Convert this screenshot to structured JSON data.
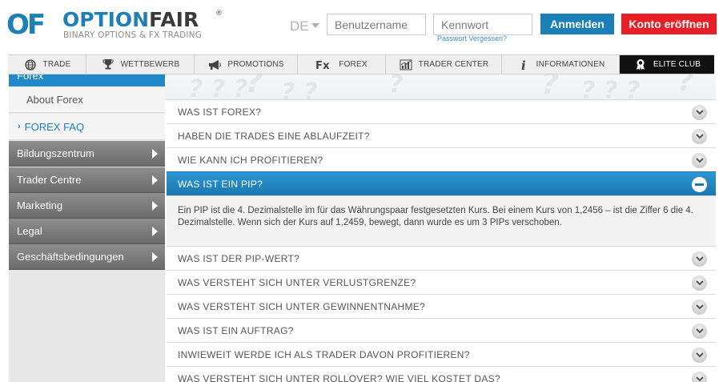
{
  "brand": {
    "logo_mark": "OF",
    "name_part1": "OPTION",
    "name_part2": "FAIR",
    "registered": "®",
    "tagline": "BINARY OPTIONS & FX TRADING"
  },
  "header": {
    "language": "DE",
    "username_placeholder": "Benutzername",
    "password_placeholder": "Kennwort",
    "forgot_password": "Passwort Vergessen?",
    "login_label": "Anmelden",
    "open_account_label": "Konto eröffnen",
    "colors": {
      "primary": "#1b7fb8",
      "danger": "#e81f24"
    }
  },
  "nav": {
    "items": [
      {
        "label": "TRADE",
        "icon": "globe-icon"
      },
      {
        "label": "WETTBEWERB",
        "icon": "trophy-icon"
      },
      {
        "label": "PROMOTIONS",
        "icon": "megaphone-icon"
      },
      {
        "label": "FOREX",
        "icon": "fx-icon"
      },
      {
        "label": "TRADER CENTER",
        "icon": "chart-icon"
      },
      {
        "label": "INFORMATIONEN",
        "icon": "info-icon"
      },
      {
        "label": "ELITE CLUB",
        "icon": "award-icon"
      }
    ]
  },
  "sidebar": {
    "active_section": "Forex",
    "sub_items": [
      {
        "label": "About Forex"
      },
      {
        "label": "FOREX FAQ",
        "chevron": "›"
      }
    ],
    "categories": [
      {
        "label": "Bildungszentrum"
      },
      {
        "label": "Trader Centre"
      },
      {
        "label": "Marketing"
      },
      {
        "label": "Legal"
      },
      {
        "label": "Geschäftsbedingungen"
      }
    ]
  },
  "faq": {
    "items": [
      {
        "question": "WAS IST FOREX?"
      },
      {
        "question": "HABEN DIE TRADES EINE ABLAUFZEIT?"
      },
      {
        "question": "WIE KANN ICH PROFITIEREN?"
      },
      {
        "question": "WAS IST EIN PIP?",
        "answer": "Ein PIP ist die 4. Dezimalstelle im für das Währungspaar festgesetzten Kurs. Bei einem Kurs von 1,2456 – ist die Ziffer 6 die 4. Dezimalstelle. Wenn sich der Kurs auf 1,2459, bewegt, dann wurde es um 3 PIPs verschoben."
      },
      {
        "question": "WAS IST DER PIP-WERT?"
      },
      {
        "question": "WAS VERSTEHT SICH UNTER VERLUSTGRENZE?"
      },
      {
        "question": "WAS VERSTEHT SICH UNTER GEWINNENTNAHME?"
      },
      {
        "question": "WAS IST EIN AUFTRAG?"
      },
      {
        "question": "INWIEWEIT WERDE ICH ALS TRADER DAVON PROFITIEREN?"
      },
      {
        "question": "WAS VERSTEHT SICH UNTER ROLLOVER? WIE VIEL KOSTET DAS?"
      }
    ]
  }
}
